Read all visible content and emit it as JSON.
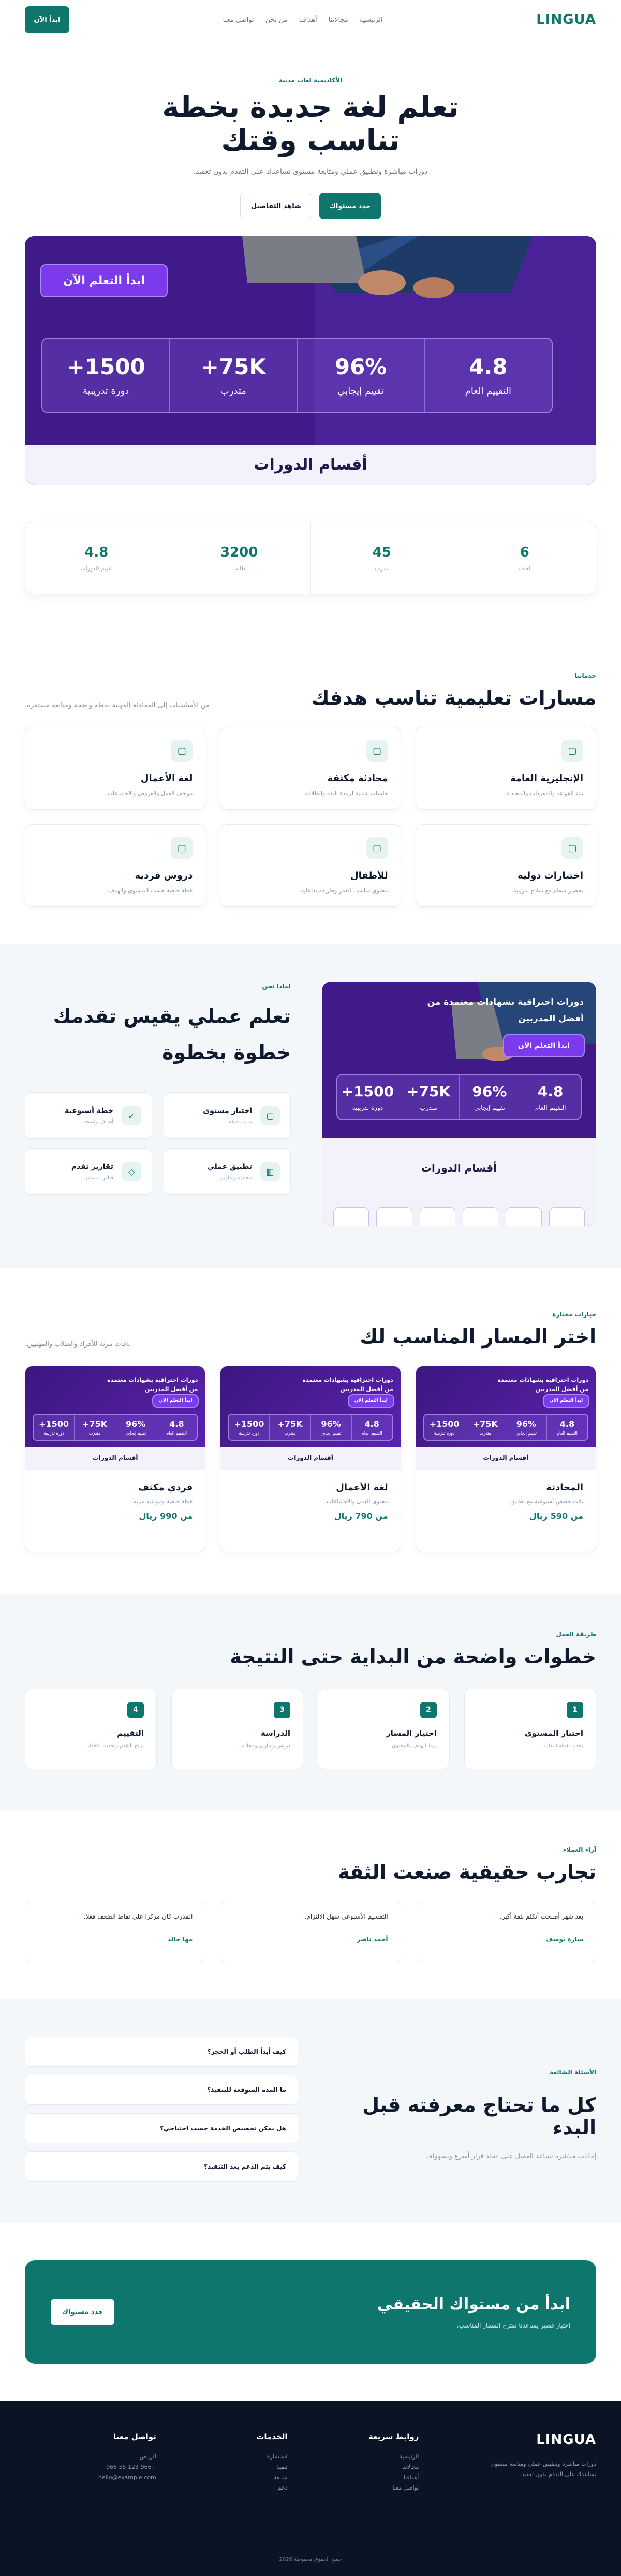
{
  "nav": {
    "logo": "LINGUA",
    "links": [
      "الرئيسية",
      "مجالاتنا",
      "أهدافنا",
      "من نحن",
      "تواصل معنا"
    ],
    "cta": "ابدأ الآن"
  },
  "hero": {
    "eyebrow": "الأكاديمية لغات مدينة",
    "title": "تعلم لغة جديدة بخطة تناسب وقتك",
    "subtitle": "دورات مباشرة وتطبيق عملي ومتابعة مستوى تساعدك على التقدم بدون تعقيد.",
    "primary_button": "حدد مستواك",
    "secondary_button": "شاهد التفاصيل"
  },
  "promo": {
    "cta": "ابدأ التعلم الآن",
    "headline": "دورات احترافية بشهادات معتمدة من أفضل المدربين",
    "stats": [
      {
        "value": "4.8",
        "label": "التقييم العام"
      },
      {
        "value": "96%",
        "label": "تقييم إيجابي"
      },
      {
        "value": "75K+",
        "label": "متدرب"
      },
      {
        "value": "1500+",
        "label": "دورة تدريبية"
      }
    ],
    "section_title": "أقسام الدورات"
  },
  "stats": [
    {
      "value": "6",
      "label": "لغات"
    },
    {
      "value": "45",
      "label": "مدرب"
    },
    {
      "value": "3200",
      "label": "طالب"
    },
    {
      "value": "4.8",
      "label": "تقييم الدورات"
    }
  ],
  "programs": {
    "eyebrow": "خدماتنا",
    "title": "مسارات تعليمية تناسب هدفك",
    "description": "من الأساسيات إلى المحادثة المهنية بخطة واضحة ومتابعة مستمرة.",
    "cards": [
      {
        "title": "الإنجليزية العامة",
        "text": "بناء القواعد والمفردات والمحادثة."
      },
      {
        "title": "محادثة مكثفة",
        "text": "جلسات عملية لزيادة الثقة والطلاقة."
      },
      {
        "title": "لغة الأعمال",
        "text": "مواقف العمل والعروض والاجتماعات."
      },
      {
        "title": "اختبارات دولية",
        "text": "تحضير منظم مع نماذج تدريبية."
      },
      {
        "title": "للأطفال",
        "text": "محتوى مناسب للعمر وطريقة تفاعلية."
      },
      {
        "title": "دروس فردية",
        "text": "خطة خاصة حسب المستوى والهدف."
      }
    ]
  },
  "why": {
    "eyebrow": "لماذا نحن",
    "title": "تعلم عملي يقيس تقدمك خطوة بخطوة",
    "features": [
      {
        "title": "اختبار مستوى",
        "text": "بداية دقيقة"
      },
      {
        "title": "خطة أسبوعية",
        "text": "أهداف واضحة"
      },
      {
        "title": "تطبيق عملي",
        "text": "محادثة وتمارين"
      },
      {
        "title": "تقارير تقدم",
        "text": "قياس مستمر"
      }
    ]
  },
  "plans": {
    "eyebrow": "خيارات مختارة",
    "title": "اختر المسار المناسب لك",
    "description": "باقات مرنة للأفراد والطلاب والمهنيين.",
    "cards": [
      {
        "title": "المحادثة",
        "text": "ثلاث حصص أسبوعية مع تطبيق.",
        "price": "من 590 ريال"
      },
      {
        "title": "لغة الأعمال",
        "text": "محتوى العمل والاجتماعات.",
        "price": "من 790 ريال"
      },
      {
        "title": "فردي مكثف",
        "text": "خطة خاصة ومواعيد مرنة.",
        "price": "من 990 ريال"
      }
    ]
  },
  "steps": {
    "eyebrow": "طريقة العمل",
    "title": "خطوات واضحة من البداية حتى النتيجة",
    "items": [
      {
        "num": "1",
        "title": "اختبار المستوى",
        "text": "تحديد نقطة البداية."
      },
      {
        "num": "2",
        "title": "اختيار المسار",
        "text": "ربط الهدف بالمحتوى."
      },
      {
        "num": "3",
        "title": "الدراسة",
        "text": "دروس وتمارين ومحادثة."
      },
      {
        "num": "4",
        "title": "التقييم",
        "text": "نتائج التقدم وتحديث الخطة."
      }
    ]
  },
  "testimonials": {
    "eyebrow": "آراء العملاء",
    "title": "تجارب حقيقية صنعت الثقة",
    "items": [
      {
        "quote": "بعد شهر أصبحت أتكلم بثقة أكبر.",
        "name": "سارة يوسف"
      },
      {
        "quote": "التقسيم الأسبوعي سهل الالتزام.",
        "name": "أحمد ناصر"
      },
      {
        "quote": "المدرب كان مركزا على نقاط الضعف فعلا.",
        "name": "مها خالد"
      }
    ]
  },
  "faq": {
    "eyebrow": "الأسئلة الشائعة",
    "title": "كل ما تحتاج معرفته قبل البدء",
    "description": "إجابات مباشرة تساعد العميل على اتخاذ قرار أسرع وبسهولة.",
    "questions": [
      "كيف أبدأ الطلب أو الحجز؟",
      "ما المدة المتوقعة للتنفيذ؟",
      "هل يمكن تخصيص الخدمة حسب احتياجي؟",
      "كيف يتم الدعم بعد التنفيذ؟"
    ]
  },
  "cta": {
    "title": "ابدأ من مستواك الحقيقي",
    "text": "اختبار قصير يساعدنا نقترح المسار المناسب.",
    "button": "حدد مستواك"
  },
  "footer": {
    "logo": "LINGUA",
    "description": "دورات مباشرة وتطبيق عملي ومتابعة مستوى تساعدك على التقدم بدون تعقيد.",
    "columns": [
      {
        "title": "روابط سريعة",
        "items": [
          "الرئيسية",
          "مجالاتنا",
          "أهدافنا",
          "تواصل معنا"
        ]
      },
      {
        "title": "الخدمات",
        "items": [
          "استشارة",
          "تنفيذ",
          "متابعة",
          "دعم"
        ]
      },
      {
        "title": "تواصل معنا",
        "items": [
          "الرياض",
          "+966 123 55 966",
          "hello@example.com"
        ]
      }
    ],
    "copyright": "جميع الحقوق محفوظة 2026"
  }
}
